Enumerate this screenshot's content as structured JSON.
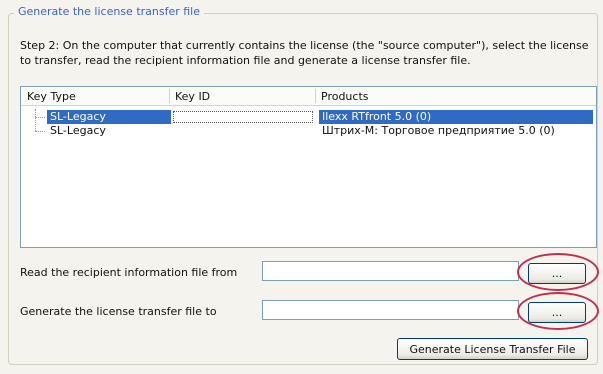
{
  "group": {
    "title": "Generate the license transfer file"
  },
  "step_text": "Step 2: On the computer that currently contains the license (the \"source computer\"), select the license to transfer, read the recipient information file and generate a license transfer file.",
  "table": {
    "columns": [
      "Key Type",
      "Key ID",
      "Products"
    ],
    "rows": [
      {
        "key_type": "SL-Legacy",
        "key_id": "",
        "products": "Ilexx RTfront 5.0 (0)",
        "selected": true
      },
      {
        "key_type": "SL-Legacy",
        "key_id": "",
        "products": "Штрих-М: Торговое предприятие 5.0 (0)",
        "selected": false
      }
    ]
  },
  "read_recipient": {
    "label": "Read the recipient information file from",
    "value": "",
    "browse_label": "..."
  },
  "generate_to": {
    "label": "Generate the license transfer file to",
    "value": "",
    "browse_label": "..."
  },
  "generate_button": "Generate License Transfer File",
  "colors": {
    "selection": "#316ac5",
    "annotation_ring": "#c0304a",
    "group_title": "#3a63c8"
  }
}
